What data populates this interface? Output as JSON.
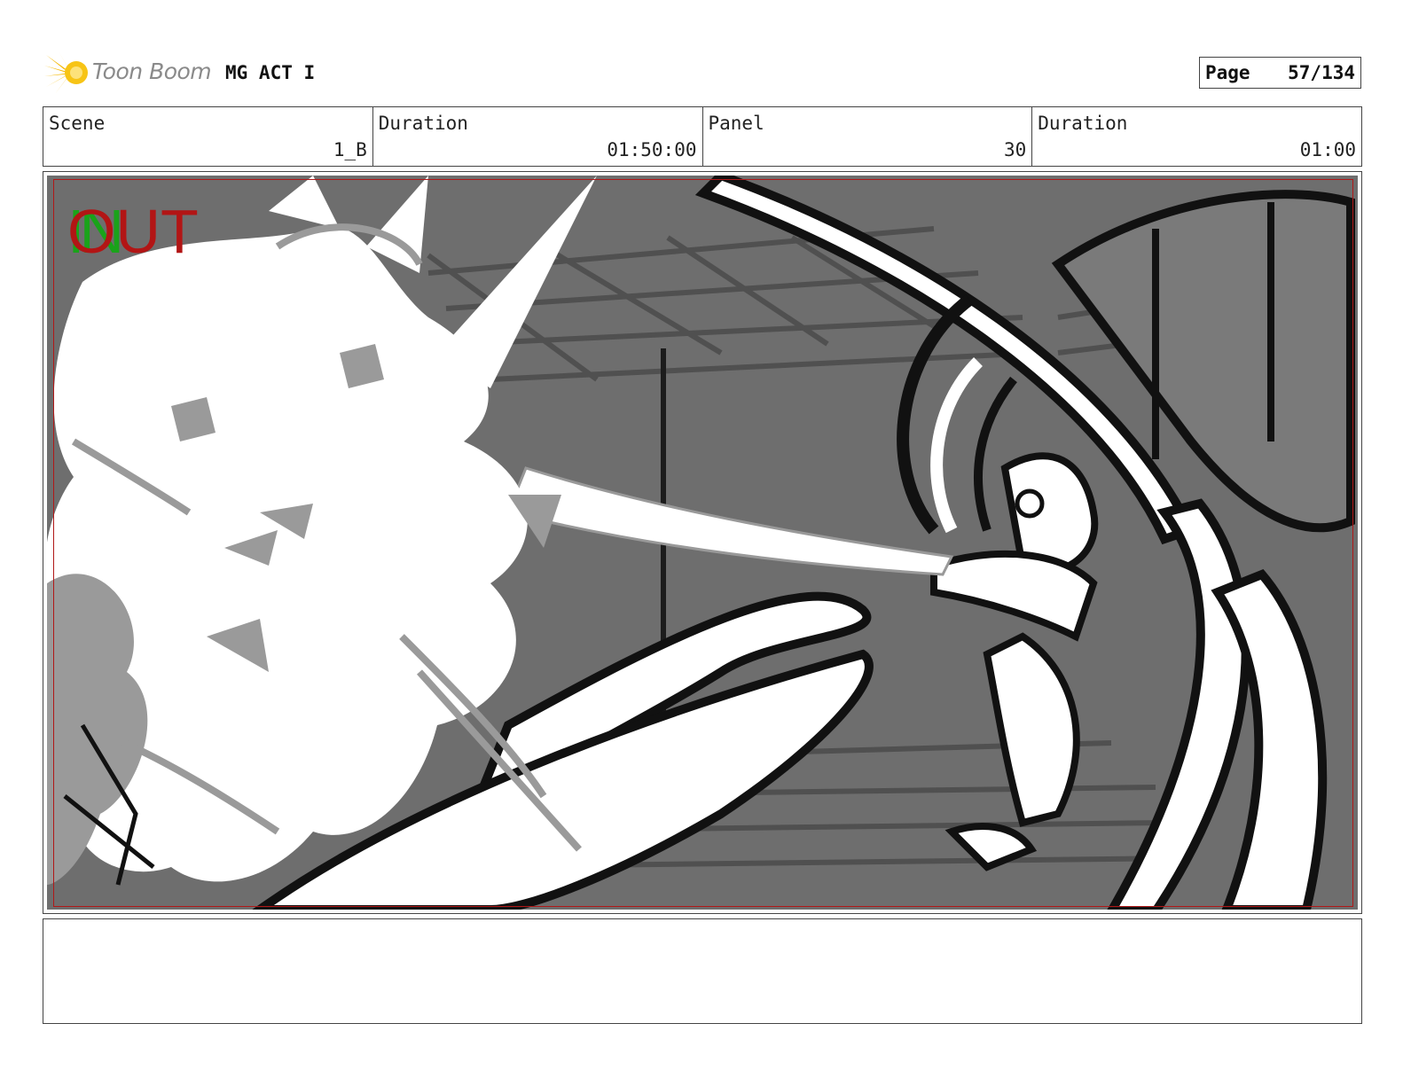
{
  "header": {
    "logo_text": "Toon Boom",
    "project_title": "MG ACT I",
    "page_label": "Page",
    "page_value": "57/134"
  },
  "info": {
    "scene_label": "Scene",
    "scene_value": "1_B",
    "scene_duration_label": "Duration",
    "scene_duration_value": "01:50:00",
    "panel_label": "Panel",
    "panel_value": "30",
    "panel_duration_label": "Duration",
    "panel_duration_value": "01:00"
  },
  "panel": {
    "in_marker": "IN",
    "out_marker": "OUT",
    "in_color": "#1aa31a",
    "out_color": "#b21515"
  },
  "notes": {
    "text": ""
  }
}
